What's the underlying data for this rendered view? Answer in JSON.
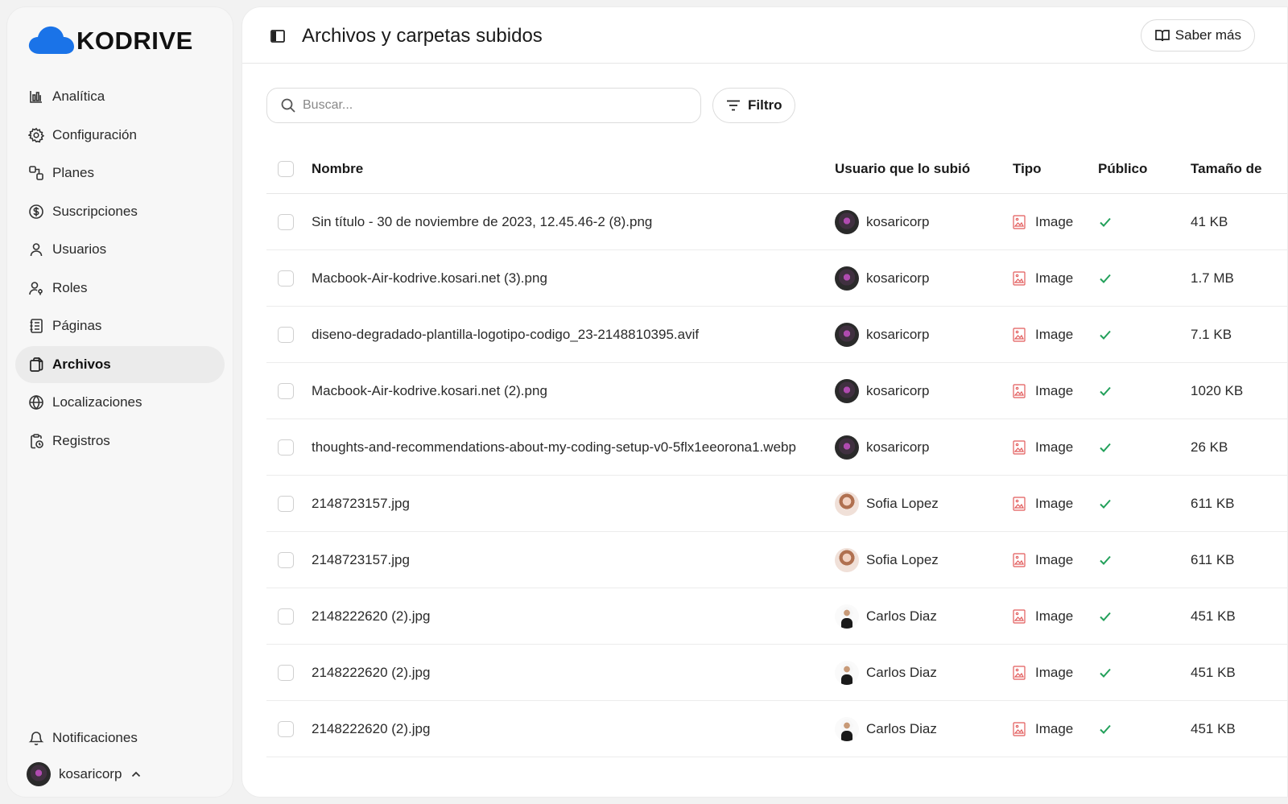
{
  "app": {
    "brand": "KODRIVE",
    "brand_color": "#1a73e8"
  },
  "sidebar": {
    "items": [
      {
        "label": "Analítica",
        "icon": "bar-chart-icon"
      },
      {
        "label": "Configuración",
        "icon": "gear-icon"
      },
      {
        "label": "Planes",
        "icon": "plans-icon"
      },
      {
        "label": "Suscripciones",
        "icon": "dollar-circle-icon"
      },
      {
        "label": "Usuarios",
        "icon": "user-icon"
      },
      {
        "label": "Roles",
        "icon": "user-key-icon"
      },
      {
        "label": "Páginas",
        "icon": "notebook-icon"
      },
      {
        "label": "Archivos",
        "icon": "files-icon",
        "active": true
      },
      {
        "label": "Localizaciones",
        "icon": "globe-icon"
      },
      {
        "label": "Registros",
        "icon": "clipboard-clock-icon"
      }
    ],
    "notifications_label": "Notificaciones",
    "current_user": "kosaricorp"
  },
  "header": {
    "title": "Archivos y carpetas subidos",
    "learn_more": "Saber más"
  },
  "toolbar": {
    "search_placeholder": "Buscar...",
    "filter_label": "Filtro"
  },
  "table": {
    "columns": [
      "Nombre",
      "Usuario que lo subió",
      "Tipo",
      "Público",
      "Tamaño de"
    ],
    "rows": [
      {
        "name": "Sin título - 30 de noviembre de 2023, 12.45.46-2 (8).png",
        "user": "kosaricorp",
        "avatar": "dark",
        "type": "Image",
        "size": "41 KB"
      },
      {
        "name": "Macbook-Air-kodrive.kosari.net (3).png",
        "user": "kosaricorp",
        "avatar": "dark",
        "type": "Image",
        "size": "1.7 MB"
      },
      {
        "name": "diseno-degradado-plantilla-logotipo-codigo_23-2148810395.avif",
        "user": "kosaricorp",
        "avatar": "dark",
        "type": "Image",
        "size": "7.1 KB"
      },
      {
        "name": "Macbook-Air-kodrive.kosari.net (2).png",
        "user": "kosaricorp",
        "avatar": "dark",
        "type": "Image",
        "size": "1020 KB"
      },
      {
        "name": "thoughts-and-recommendations-about-my-coding-setup-v0-5flx1eeorona1.webp",
        "user": "kosaricorp",
        "avatar": "dark",
        "type": "Image",
        "size": "26 KB"
      },
      {
        "name": "2148723157.jpg",
        "user": "Sofia Lopez",
        "avatar": "sofia",
        "type": "Image",
        "size": "611 KB"
      },
      {
        "name": "2148723157.jpg",
        "user": "Sofia Lopez",
        "avatar": "sofia",
        "type": "Image",
        "size": "611 KB"
      },
      {
        "name": "2148222620 (2).jpg",
        "user": "Carlos Diaz",
        "avatar": "carlos",
        "type": "Image",
        "size": "451 KB"
      },
      {
        "name": "2148222620 (2).jpg",
        "user": "Carlos Diaz",
        "avatar": "carlos",
        "type": "Image",
        "size": "451 KB"
      },
      {
        "name": "2148222620 (2).jpg",
        "user": "Carlos Diaz",
        "avatar": "carlos",
        "type": "Image",
        "size": "451 KB"
      }
    ]
  },
  "colors": {
    "check_green": "#22a05a",
    "image_icon_red": "#e25b5b"
  }
}
